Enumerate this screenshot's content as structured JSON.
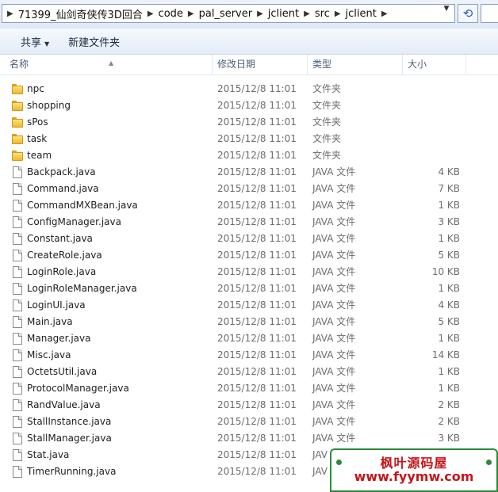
{
  "address_bar": {
    "breadcrumbs": [
      "71399_仙剑奇侠传3D回合",
      "code",
      "pal_server",
      "jclient",
      "src",
      "jclient"
    ]
  },
  "toolbar": {
    "share_label": "共享",
    "new_folder_label": "新建文件夹"
  },
  "columns": {
    "name": "名称",
    "date": "修改日期",
    "type": "类型",
    "size": "大小"
  },
  "files": [
    {
      "name": "npc",
      "date": "2015/12/8 11:01",
      "type": "文件夹",
      "size": "",
      "kind": "folder"
    },
    {
      "name": "shopping",
      "date": "2015/12/8 11:01",
      "type": "文件夹",
      "size": "",
      "kind": "folder"
    },
    {
      "name": "sPos",
      "date": "2015/12/8 11:01",
      "type": "文件夹",
      "size": "",
      "kind": "folder"
    },
    {
      "name": "task",
      "date": "2015/12/8 11:01",
      "type": "文件夹",
      "size": "",
      "kind": "folder"
    },
    {
      "name": "team",
      "date": "2015/12/8 11:01",
      "type": "文件夹",
      "size": "",
      "kind": "folder"
    },
    {
      "name": "Backpack.java",
      "date": "2015/12/8 11:01",
      "type": "JAVA 文件",
      "size": "4 KB",
      "kind": "file"
    },
    {
      "name": "Command.java",
      "date": "2015/12/8 11:01",
      "type": "JAVA 文件",
      "size": "7 KB",
      "kind": "file"
    },
    {
      "name": "CommandMXBean.java",
      "date": "2015/12/8 11:01",
      "type": "JAVA 文件",
      "size": "1 KB",
      "kind": "file"
    },
    {
      "name": "ConfigManager.java",
      "date": "2015/12/8 11:01",
      "type": "JAVA 文件",
      "size": "3 KB",
      "kind": "file"
    },
    {
      "name": "Constant.java",
      "date": "2015/12/8 11:01",
      "type": "JAVA 文件",
      "size": "1 KB",
      "kind": "file"
    },
    {
      "name": "CreateRole.java",
      "date": "2015/12/8 11:01",
      "type": "JAVA 文件",
      "size": "5 KB",
      "kind": "file"
    },
    {
      "name": "LoginRole.java",
      "date": "2015/12/8 11:01",
      "type": "JAVA 文件",
      "size": "10 KB",
      "kind": "file"
    },
    {
      "name": "LoginRoleManager.java",
      "date": "2015/12/8 11:01",
      "type": "JAVA 文件",
      "size": "1 KB",
      "kind": "file"
    },
    {
      "name": "LoginUI.java",
      "date": "2015/12/8 11:01",
      "type": "JAVA 文件",
      "size": "4 KB",
      "kind": "file"
    },
    {
      "name": "Main.java",
      "date": "2015/12/8 11:01",
      "type": "JAVA 文件",
      "size": "5 KB",
      "kind": "file"
    },
    {
      "name": "Manager.java",
      "date": "2015/12/8 11:01",
      "type": "JAVA 文件",
      "size": "1 KB",
      "kind": "file"
    },
    {
      "name": "Misc.java",
      "date": "2015/12/8 11:01",
      "type": "JAVA 文件",
      "size": "14 KB",
      "kind": "file"
    },
    {
      "name": "OctetsUtil.java",
      "date": "2015/12/8 11:01",
      "type": "JAVA 文件",
      "size": "1 KB",
      "kind": "file"
    },
    {
      "name": "ProtocolManager.java",
      "date": "2015/12/8 11:01",
      "type": "JAVA 文件",
      "size": "1 KB",
      "kind": "file"
    },
    {
      "name": "RandValue.java",
      "date": "2015/12/8 11:01",
      "type": "JAVA 文件",
      "size": "2 KB",
      "kind": "file"
    },
    {
      "name": "StallInstance.java",
      "date": "2015/12/8 11:01",
      "type": "JAVA 文件",
      "size": "2 KB",
      "kind": "file"
    },
    {
      "name": "StallManager.java",
      "date": "2015/12/8 11:01",
      "type": "JAVA 文件",
      "size": "3 KB",
      "kind": "file"
    },
    {
      "name": "Stat.java",
      "date": "2015/12/8 11:01",
      "type": "JAV",
      "size": "",
      "kind": "file"
    },
    {
      "name": "TimerRunning.java",
      "date": "2015/12/8 11:01",
      "type": "JAV",
      "size": "",
      "kind": "file"
    }
  ],
  "watermark": {
    "line1": "枫叶源码屋",
    "line2": "www.fyymw.com"
  },
  "icons": {
    "folder": "folder-icon",
    "file": "file-icon",
    "refresh": "refresh-icon",
    "dropdown": "chevron-down-icon"
  },
  "colors": {
    "folder": "#f0b830",
    "watermark_text": "#c4161c",
    "watermark_border": "#2c8a3a"
  }
}
